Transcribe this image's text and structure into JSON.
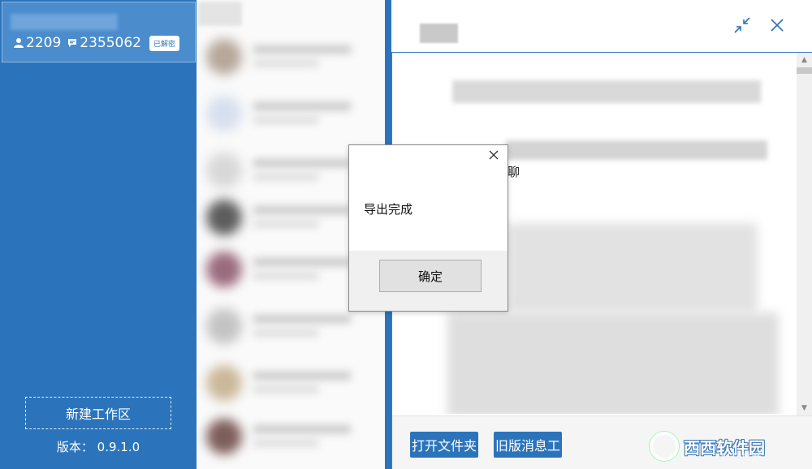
{
  "sidebar": {
    "account": {
      "contacts_count": "2209",
      "messages_count": "2355062",
      "decrypt_badge": "已解密"
    },
    "new_workspace_label": "新建工作区",
    "version_label": "版本：",
    "version_value": "0.9.1.0"
  },
  "panel": {
    "chat_text": "聊",
    "buttons": {
      "open_folder": "打开文件夹",
      "old_version_tool": "旧版消息工"
    },
    "icons": {
      "collapse": "collapse-icon",
      "close": "close-icon"
    }
  },
  "dialog": {
    "message": "导出完成",
    "ok_label": "确定"
  },
  "watermark": {
    "text": "西西软件园",
    "sub": "CR173.COM"
  },
  "colors": {
    "accent": "#2b74bb",
    "sidebar_bg": "#2b74bb",
    "dialog_button_bg": "#e1e1e1"
  }
}
